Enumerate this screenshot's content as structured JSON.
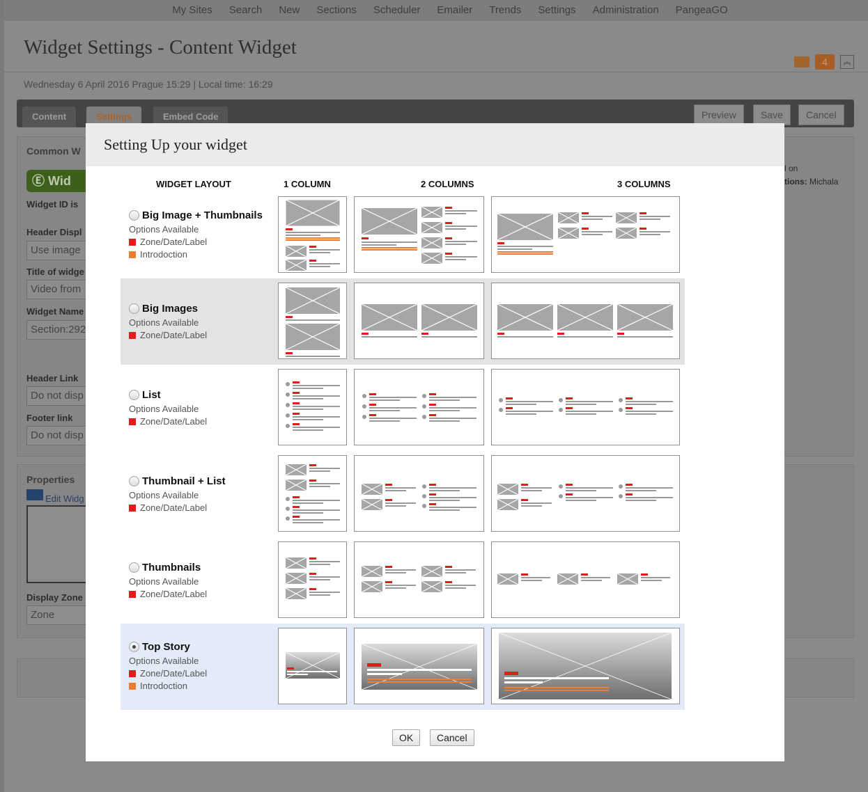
{
  "nav": [
    "My Sites",
    "Search",
    "New",
    "Sections",
    "Scheduler",
    "Emailer",
    "Trends",
    "Settings",
    "Administration",
    "PangeaGO"
  ],
  "page": {
    "title": "Widget Settings - Content Widget",
    "badge_count": "4",
    "datetime": "Wednesday 6 April 2016 Prague 15:29 | Local time: 16:29",
    "tabs": [
      "Content",
      "Settings",
      "Embed Code"
    ],
    "buttons": {
      "preview": "Preview",
      "save": "Save",
      "cancel": "Cancel"
    },
    "common_heading": "Common W",
    "widget_pill": "Wid",
    "widget_id_label": "Widget ID is",
    "header_display_label": "Header Displ",
    "header_display_value": "Use image",
    "title_of_widget_label": "Title of widge",
    "title_value": "Video from",
    "widget_name_label": "Widget Name",
    "widget_name_value": "Section:292",
    "header_link_label": "Header Link",
    "header_link_value": "Do not disp",
    "footer_link_label": "Footer link",
    "footer_link_value": "Do not disp",
    "properties_label": "Properties",
    "edit_widget_link": "Edit Widg",
    "display_zone_label": "Display Zone",
    "display_zone_value": "Zone",
    "right_note_1": "l on",
    "right_note_2_bold": "tions:",
    "right_note_2": " Michala"
  },
  "dialog": {
    "title": "Setting Up your widget",
    "headers": {
      "layout": "WIDGET LAYOUT",
      "col1": "1 COLUMN",
      "col2": "2 COLUMNS",
      "col3": "3 COLUMNS"
    },
    "options": [
      {
        "name": "Big Image + Thumbnails",
        "sub": "Options Available",
        "legend": [
          {
            "color": "red",
            "text": "Zone/Date/Label"
          },
          {
            "color": "orange",
            "text": "Introdoction"
          }
        ],
        "selected": false
      },
      {
        "name": "Big Images",
        "sub": "Options Available",
        "legend": [
          {
            "color": "red",
            "text": "Zone/Date/Label"
          }
        ],
        "selected": false
      },
      {
        "name": "List",
        "sub": "Options Available",
        "legend": [
          {
            "color": "red",
            "text": "Zone/Date/Label"
          }
        ],
        "selected": false
      },
      {
        "name": "Thumbnail + List",
        "sub": "Options Available",
        "legend": [
          {
            "color": "red",
            "text": "Zone/Date/Label"
          }
        ],
        "selected": false
      },
      {
        "name": "Thumbnails",
        "sub": "Options Available",
        "legend": [
          {
            "color": "red",
            "text": "Zone/Date/Label"
          }
        ],
        "selected": false
      },
      {
        "name": "Top Story",
        "sub": "Options Available",
        "legend": [
          {
            "color": "red",
            "text": "Zone/Date/Label"
          },
          {
            "color": "orange",
            "text": "Introdoction"
          }
        ],
        "selected": true
      }
    ],
    "ok": "OK",
    "cancel": "Cancel"
  },
  "colors": {
    "accent_red": "#e21b1b",
    "accent_orange": "#f07c32",
    "placeholder_grey": "#a6a6a6"
  }
}
